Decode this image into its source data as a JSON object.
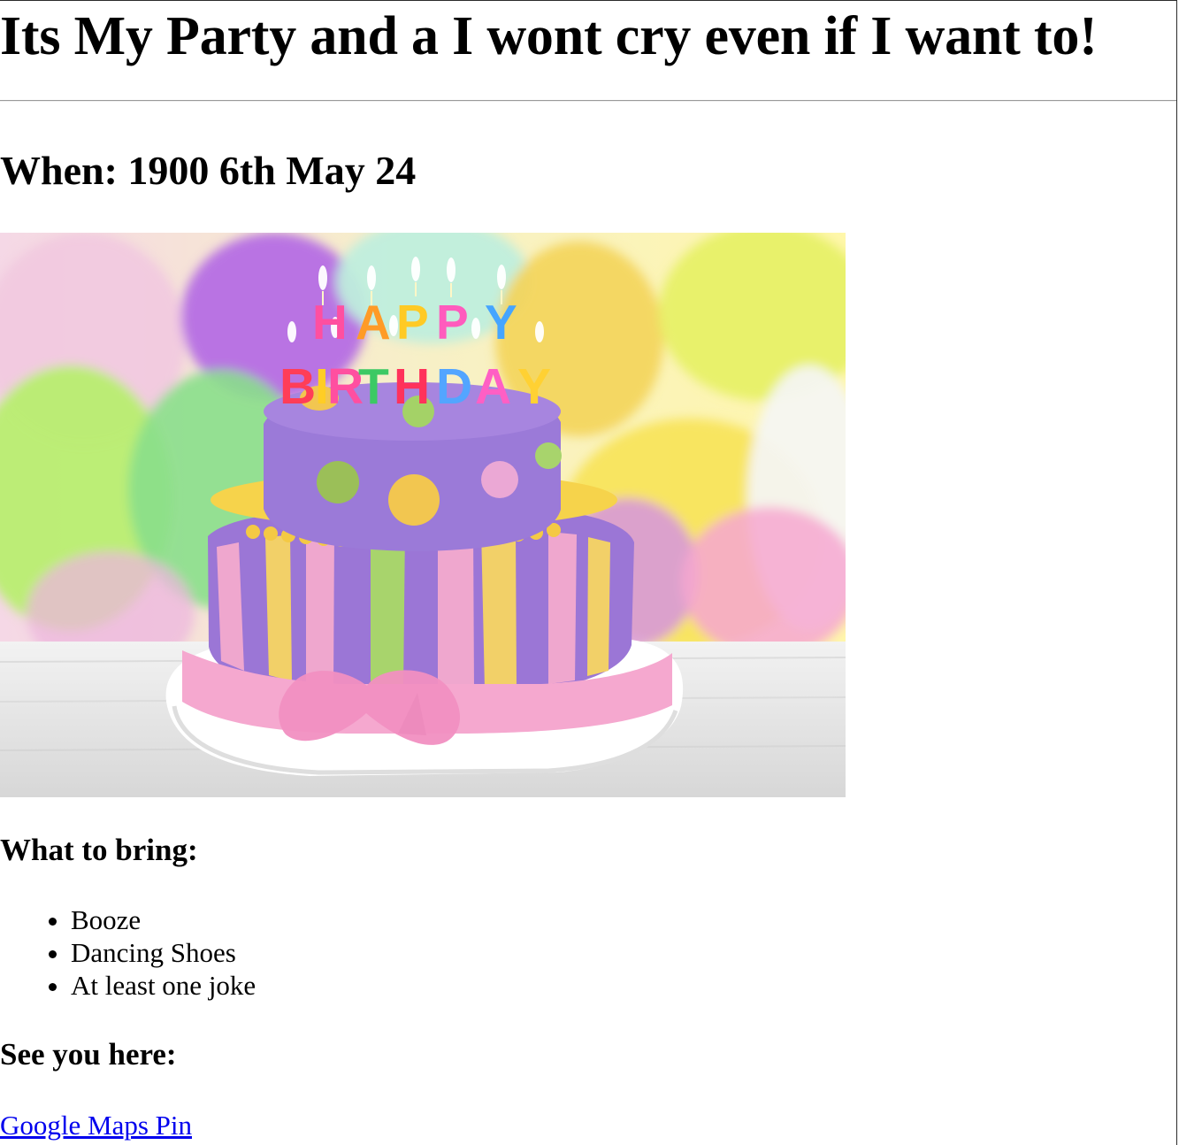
{
  "page": {
    "title": "Its My Party and a I wont cry even if I want to!",
    "when": "When: 1900 6th May 24",
    "image": {
      "subject": "birthday cake",
      "candle_text": "HAPPY BIRTHDAY"
    },
    "bring": {
      "heading": "What to bring:",
      "items": [
        {
          "label": "Booze"
        },
        {
          "label": "Dancing Shoes"
        },
        {
          "label": "At least one joke"
        }
      ]
    },
    "location": {
      "heading": "See you here:",
      "link_label": "Google Maps Pin"
    }
  },
  "colors": {
    "link": "#0000ee",
    "rule": "#9a9a9a",
    "text": "#000000"
  }
}
